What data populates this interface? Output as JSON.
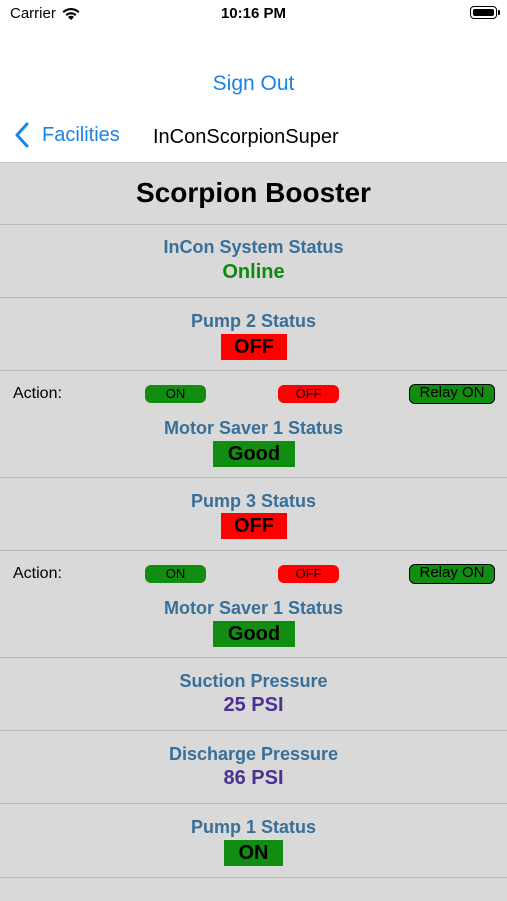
{
  "status_bar": {
    "carrier": "Carrier",
    "time": "10:16 PM"
  },
  "header": {
    "sign_out": "Sign Out"
  },
  "nav": {
    "back_label": "Facilities",
    "title": "InConScorpionSuper"
  },
  "main": {
    "title": "Scorpion Booster",
    "system_status": {
      "label": "InCon System Status",
      "value": "Online"
    },
    "pump2": {
      "label": "Pump 2 Status",
      "value": "OFF"
    },
    "action1": {
      "label": "Action:",
      "on": "ON",
      "off": "OFF",
      "relay": "Relay ON"
    },
    "motor_saver1": {
      "label": "Motor Saver 1 Status",
      "value": "Good"
    },
    "pump3": {
      "label": "Pump 3 Status",
      "value": "OFF"
    },
    "action2": {
      "label": "Action:",
      "on": "ON",
      "off": "OFF",
      "relay": "Relay ON"
    },
    "motor_saver2": {
      "label": "Motor Saver 1 Status",
      "value": "Good"
    },
    "suction": {
      "label": "Suction Pressure",
      "value": "25 PSI"
    },
    "discharge": {
      "label": "Discharge Pressure",
      "value": "86 PSI"
    },
    "pump1": {
      "label": "Pump 1 Status",
      "value": "ON"
    }
  },
  "colors": {
    "link_blue": "#1a84e6",
    "label_blue": "#3a6f98",
    "online_green": "#0f8a10",
    "badge_green": "#118d11",
    "badge_red": "#ff0000",
    "pressure_purple": "#4d3191",
    "panel_gray": "#d9d9d9"
  }
}
